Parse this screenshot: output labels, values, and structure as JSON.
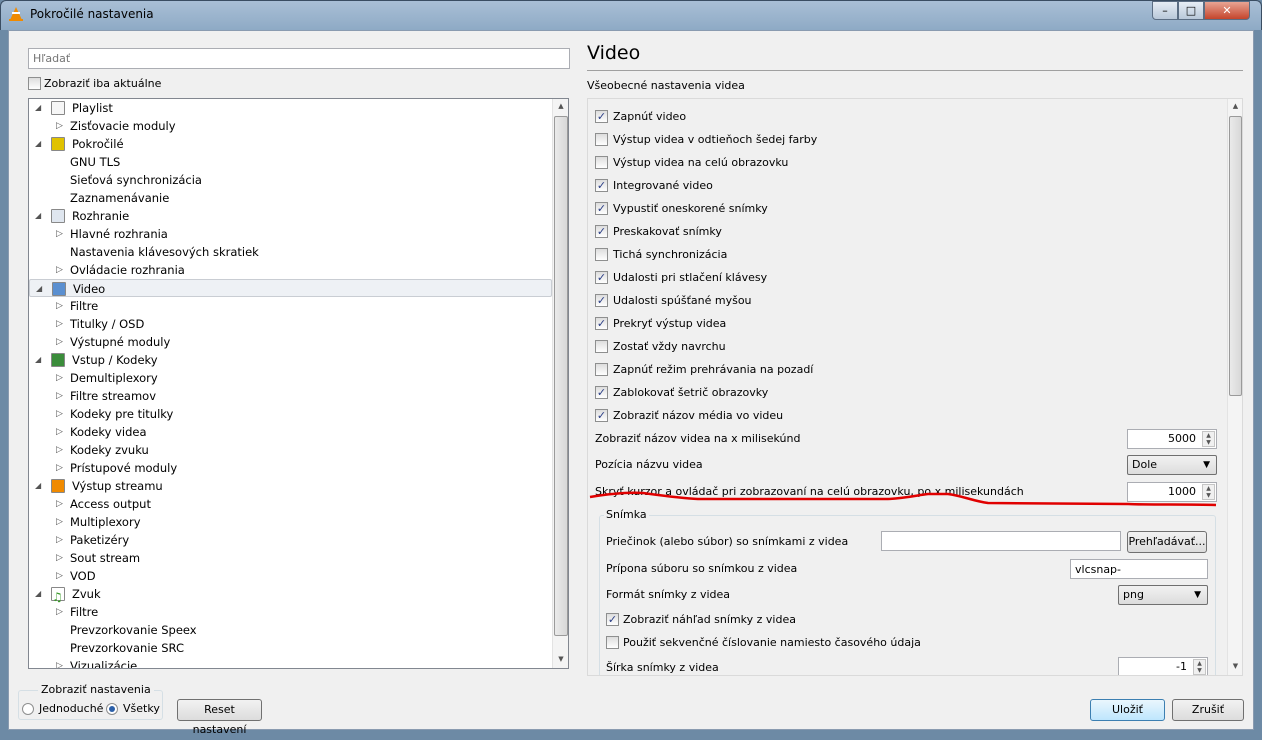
{
  "window": {
    "title": "Pokročilé nastavenia",
    "controls": [
      "–",
      "□",
      "✕"
    ]
  },
  "left": {
    "search_placeholder": "Hľadať",
    "show_current_only": {
      "label": "Zobraziť iba aktuálne",
      "checked": false
    },
    "tree": [
      {
        "label": "Playlist",
        "level": 0,
        "icon": "playlist-icon",
        "expanded": true
      },
      {
        "label": "Zisťovacie moduly",
        "level": 1,
        "arrow": true
      },
      {
        "label": "Pokročilé",
        "level": 0,
        "icon": "chip-icon",
        "expanded": true
      },
      {
        "label": "GNU TLS",
        "level": 1
      },
      {
        "label": "Sieťová synchronizácia",
        "level": 1
      },
      {
        "label": "Zaznamenávanie",
        "level": 1
      },
      {
        "label": "Rozhranie",
        "level": 0,
        "icon": "interface-icon",
        "expanded": true
      },
      {
        "label": "Hlavné rozhrania",
        "level": 1,
        "arrow": true
      },
      {
        "label": "Nastavenia klávesových skratiek",
        "level": 1
      },
      {
        "label": "Ovládacie rozhrania",
        "level": 1,
        "arrow": true
      },
      {
        "label": "Video",
        "level": 0,
        "icon": "video-icon",
        "expanded": true,
        "selected": true
      },
      {
        "label": "Filtre",
        "level": 1,
        "arrow": true
      },
      {
        "label": "Titulky / OSD",
        "level": 1,
        "arrow": true
      },
      {
        "label": "Výstupné moduly",
        "level": 1,
        "arrow": true
      },
      {
        "label": "Vstup / Kodeky",
        "level": 0,
        "icon": "codec-icon",
        "expanded": true
      },
      {
        "label": "Demultiplexory",
        "level": 1,
        "arrow": true
      },
      {
        "label": "Filtre streamov",
        "level": 1,
        "arrow": true
      },
      {
        "label": "Kodeky pre titulky",
        "level": 1,
        "arrow": true
      },
      {
        "label": "Kodeky videa",
        "level": 1,
        "arrow": true
      },
      {
        "label": "Kodeky zvuku",
        "level": 1,
        "arrow": true
      },
      {
        "label": "Prístupové moduly",
        "level": 1,
        "arrow": true
      },
      {
        "label": "Výstup streamu",
        "level": 0,
        "icon": "stream-output-icon",
        "expanded": true
      },
      {
        "label": "Access output",
        "level": 1,
        "arrow": true
      },
      {
        "label": "Multiplexory",
        "level": 1,
        "arrow": true
      },
      {
        "label": "Paketizéry",
        "level": 1,
        "arrow": true
      },
      {
        "label": "Sout stream",
        "level": 1,
        "arrow": true
      },
      {
        "label": "VOD",
        "level": 1,
        "arrow": true
      },
      {
        "label": "Zvuk",
        "level": 0,
        "icon": "music-note-icon",
        "expanded": true
      },
      {
        "label": "Filtre",
        "level": 1,
        "arrow": true
      },
      {
        "label": "Prevzorkovanie Speex",
        "level": 1
      },
      {
        "label": "Prevzorkovanie SRC",
        "level": 1
      },
      {
        "label": "Vizualizácie",
        "level": 1,
        "arrow": true
      }
    ]
  },
  "right": {
    "title": "Video",
    "section": "Všeobecné nastavenia videa",
    "checkboxes": [
      {
        "label": "Zapnúť video",
        "checked": true
      },
      {
        "label": "Výstup videa v odtieňoch šedej farby",
        "checked": false
      },
      {
        "label": "Výstup videa na celú obrazovku",
        "checked": false
      },
      {
        "label": "Integrované video",
        "checked": true
      },
      {
        "label": "Vypustiť oneskorené snímky",
        "checked": true
      },
      {
        "label": "Preskakovať snímky",
        "checked": true
      },
      {
        "label": "Tichá synchronizácia",
        "checked": false
      },
      {
        "label": "Udalosti pri stlačení klávesy",
        "checked": true
      },
      {
        "label": "Udalosti spúšťané myšou",
        "checked": true
      },
      {
        "label": "Prekryť výstup videa",
        "checked": true
      },
      {
        "label": "Zostať vždy navrchu",
        "checked": false
      },
      {
        "label": "Zapnúť režim prehrávania na pozadí",
        "checked": false
      },
      {
        "label": "Zablokovať šetrič obrazovky",
        "checked": true
      },
      {
        "label": "Zobraziť názov média vo videu",
        "checked": true
      }
    ],
    "title_timeout": {
      "label": "Zobraziť názov videa na x milisekúnd",
      "value": "5000"
    },
    "title_position": {
      "label": "Pozícia názvu videa",
      "value": "Dole"
    },
    "hide_cursor": {
      "label": "Skryť kurzor a ovládač pri zobrazovaní na celú obrazovku, po x milisekundách",
      "value": "1000"
    },
    "annotation_color": "#e00000",
    "snapshot": {
      "group": "Snímka",
      "dir_label": "Priečinok (alebo súbor) so snímkami z videa",
      "dir_value": "",
      "browse": "Prehľadávať...",
      "prefix_label": "Prípona súboru so snímkou z videa",
      "prefix_value": "vlcsnap-",
      "format_label": "Formát snímky z videa",
      "format_value": "png",
      "preview": {
        "label": "Zobraziť náhľad snímky z videa",
        "checked": true
      },
      "sequential": {
        "label": "Použiť sekvenčné číslovanie namiesto časového údaja",
        "checked": false
      },
      "width_label": "Šírka snímky z videa",
      "width_value": "-1"
    }
  },
  "bottom": {
    "show_settings": "Zobraziť nastavenia",
    "simple": "Jednoduché",
    "all": "Všetky",
    "selected": "Všetky",
    "reset": "Reset nastavení",
    "save": "Uložiť",
    "cancel": "Zrušiť"
  }
}
